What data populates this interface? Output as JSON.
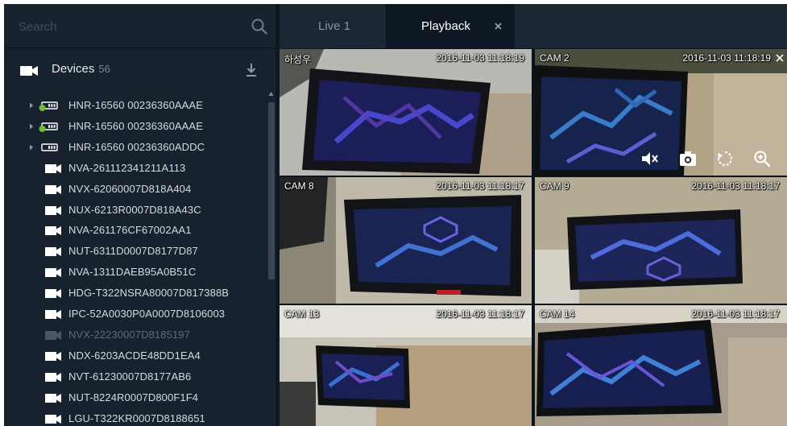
{
  "search": {
    "placeholder": "Search"
  },
  "devices": {
    "title": "Devices",
    "count": "56",
    "items": [
      {
        "label": "HNR-16560 00236360AAAE",
        "type": "recorder",
        "expandable": true,
        "online": true
      },
      {
        "label": "HNR-16560 00236360AAAE",
        "type": "recorder",
        "expandable": true,
        "online": true
      },
      {
        "label": "HNR-16560 00236360ADDC",
        "type": "recorder",
        "expandable": true,
        "online": false
      },
      {
        "label": "NVA-261112341211A113",
        "type": "camera"
      },
      {
        "label": "NVX-62060007D818A404",
        "type": "camera"
      },
      {
        "label": "NUX-6213R0007D818A43C",
        "type": "camera"
      },
      {
        "label": "NVA-261176CF67002AA1",
        "type": "camera"
      },
      {
        "label": "NUT-6311D0007D8177D87",
        "type": "camera"
      },
      {
        "label": "NVA-1311DAEB95A0B51C",
        "type": "camera"
      },
      {
        "label": "HDG-T322NSRA80007D817388B",
        "type": "camera"
      },
      {
        "label": "IPC-52A0030P0A0007D8106003",
        "type": "camera"
      },
      {
        "label": "NVX-22230007D8185197",
        "type": "camera",
        "disabled": true
      },
      {
        "label": "NDX-6203ACDE48DD1EA4",
        "type": "camera"
      },
      {
        "label": "NVT-61230007D8177AB6",
        "type": "camera"
      },
      {
        "label": "NUT-8224R0007D800F1F4",
        "type": "camera"
      },
      {
        "label": "LGU-T322KR0007D8188651",
        "type": "camera"
      }
    ]
  },
  "tabs": {
    "live": {
      "label": "Live 1"
    },
    "playback": {
      "label": "Playback"
    }
  },
  "cameras": [
    {
      "name": "하성우",
      "time": "2016-11-03 11:18:19"
    },
    {
      "name": "CAM 2",
      "time": "2016-11-03 11:18:19",
      "hovered": true
    },
    {
      "name": "CAM 8",
      "time": "2016-11-03 11:18:17"
    },
    {
      "name": "CAM 9",
      "time": "2016-11-03 11:18:17"
    },
    {
      "name": "CAM 13",
      "time": "2016-11-03 11:18:17"
    },
    {
      "name": "CAM 14",
      "time": "2016-11-03 11:18:17",
      "selected": true
    }
  ],
  "camera_controls": [
    "mute-icon",
    "snapshot-icon",
    "rotate-icon",
    "zoom-in-icon"
  ],
  "colors": {
    "sidebar_bg": "#17222e",
    "content_bg": "#0e1822",
    "tab_active": "#0e1822",
    "tab_inactive": "#1a2632",
    "online_dot": "#6fbf2b",
    "selection_outline": "#2a6db0",
    "text_primary": "#d3dae1",
    "text_disabled": "#5e6b77"
  }
}
